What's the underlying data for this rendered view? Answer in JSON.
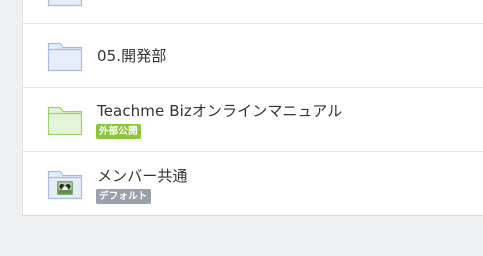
{
  "folders": [
    {
      "name": "",
      "icon": "folder-icon",
      "color": "#e6edfa",
      "stroke": "#a9bcd9"
    },
    {
      "name": "05.開発部",
      "icon": "folder-icon",
      "color": "#e6edfa",
      "stroke": "#a9bcd9"
    },
    {
      "name": "Teachme Bizオンラインマニュアル",
      "icon": "folder-icon",
      "color": "#e5f4d8",
      "stroke": "#9ccf6f",
      "badge": {
        "label": "外部公開",
        "color": "#8cc63f"
      }
    },
    {
      "name": "メンバー共通",
      "icon": "team-folder-icon",
      "color": "#e6edfa",
      "stroke": "#a9bcd9",
      "badge": {
        "label": "デフォルト",
        "color": "#9aa1aa"
      }
    }
  ]
}
